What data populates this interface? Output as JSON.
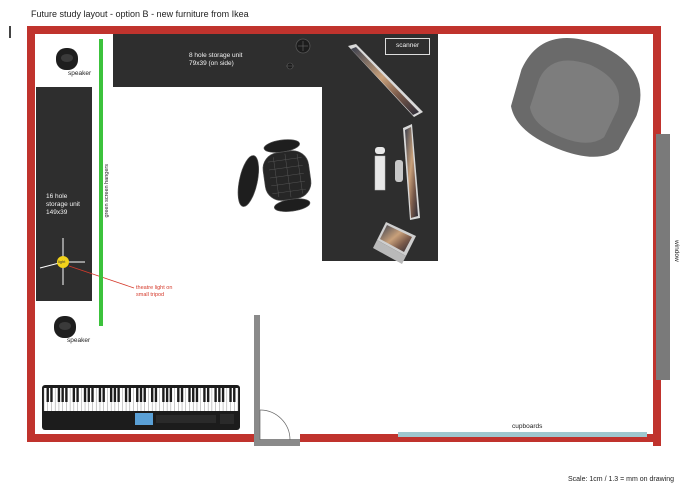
{
  "title": "Future study layout - option B - new furniture from Ikea",
  "labels": {
    "speaker_top": "speaker",
    "speaker_bottom": "speaker",
    "storage_8_line1": "8 hole storage unit",
    "storage_8_line2": "79x39 (on side)",
    "storage_16_line1": "16 hole",
    "storage_16_line2": "storage unit",
    "storage_16_line3": "149x39",
    "green_screen": "green screen hangers",
    "light_text": "light",
    "theatre_line1": "theatre light on",
    "theatre_line2": "small tripod",
    "scanner": "scanner",
    "window": "window",
    "cupboards": "cupboards",
    "scale": "Scale: 1cm / 1.3 = mm on drawing"
  },
  "colors": {
    "wall": "#c0332d",
    "furniture": "#2e2e2e",
    "green_screen": "#3cc23c",
    "window": "#7a7a7a",
    "cupboards": "#9fc8cf",
    "light": "#f2d21b",
    "armchair": "#6a6a6a"
  }
}
